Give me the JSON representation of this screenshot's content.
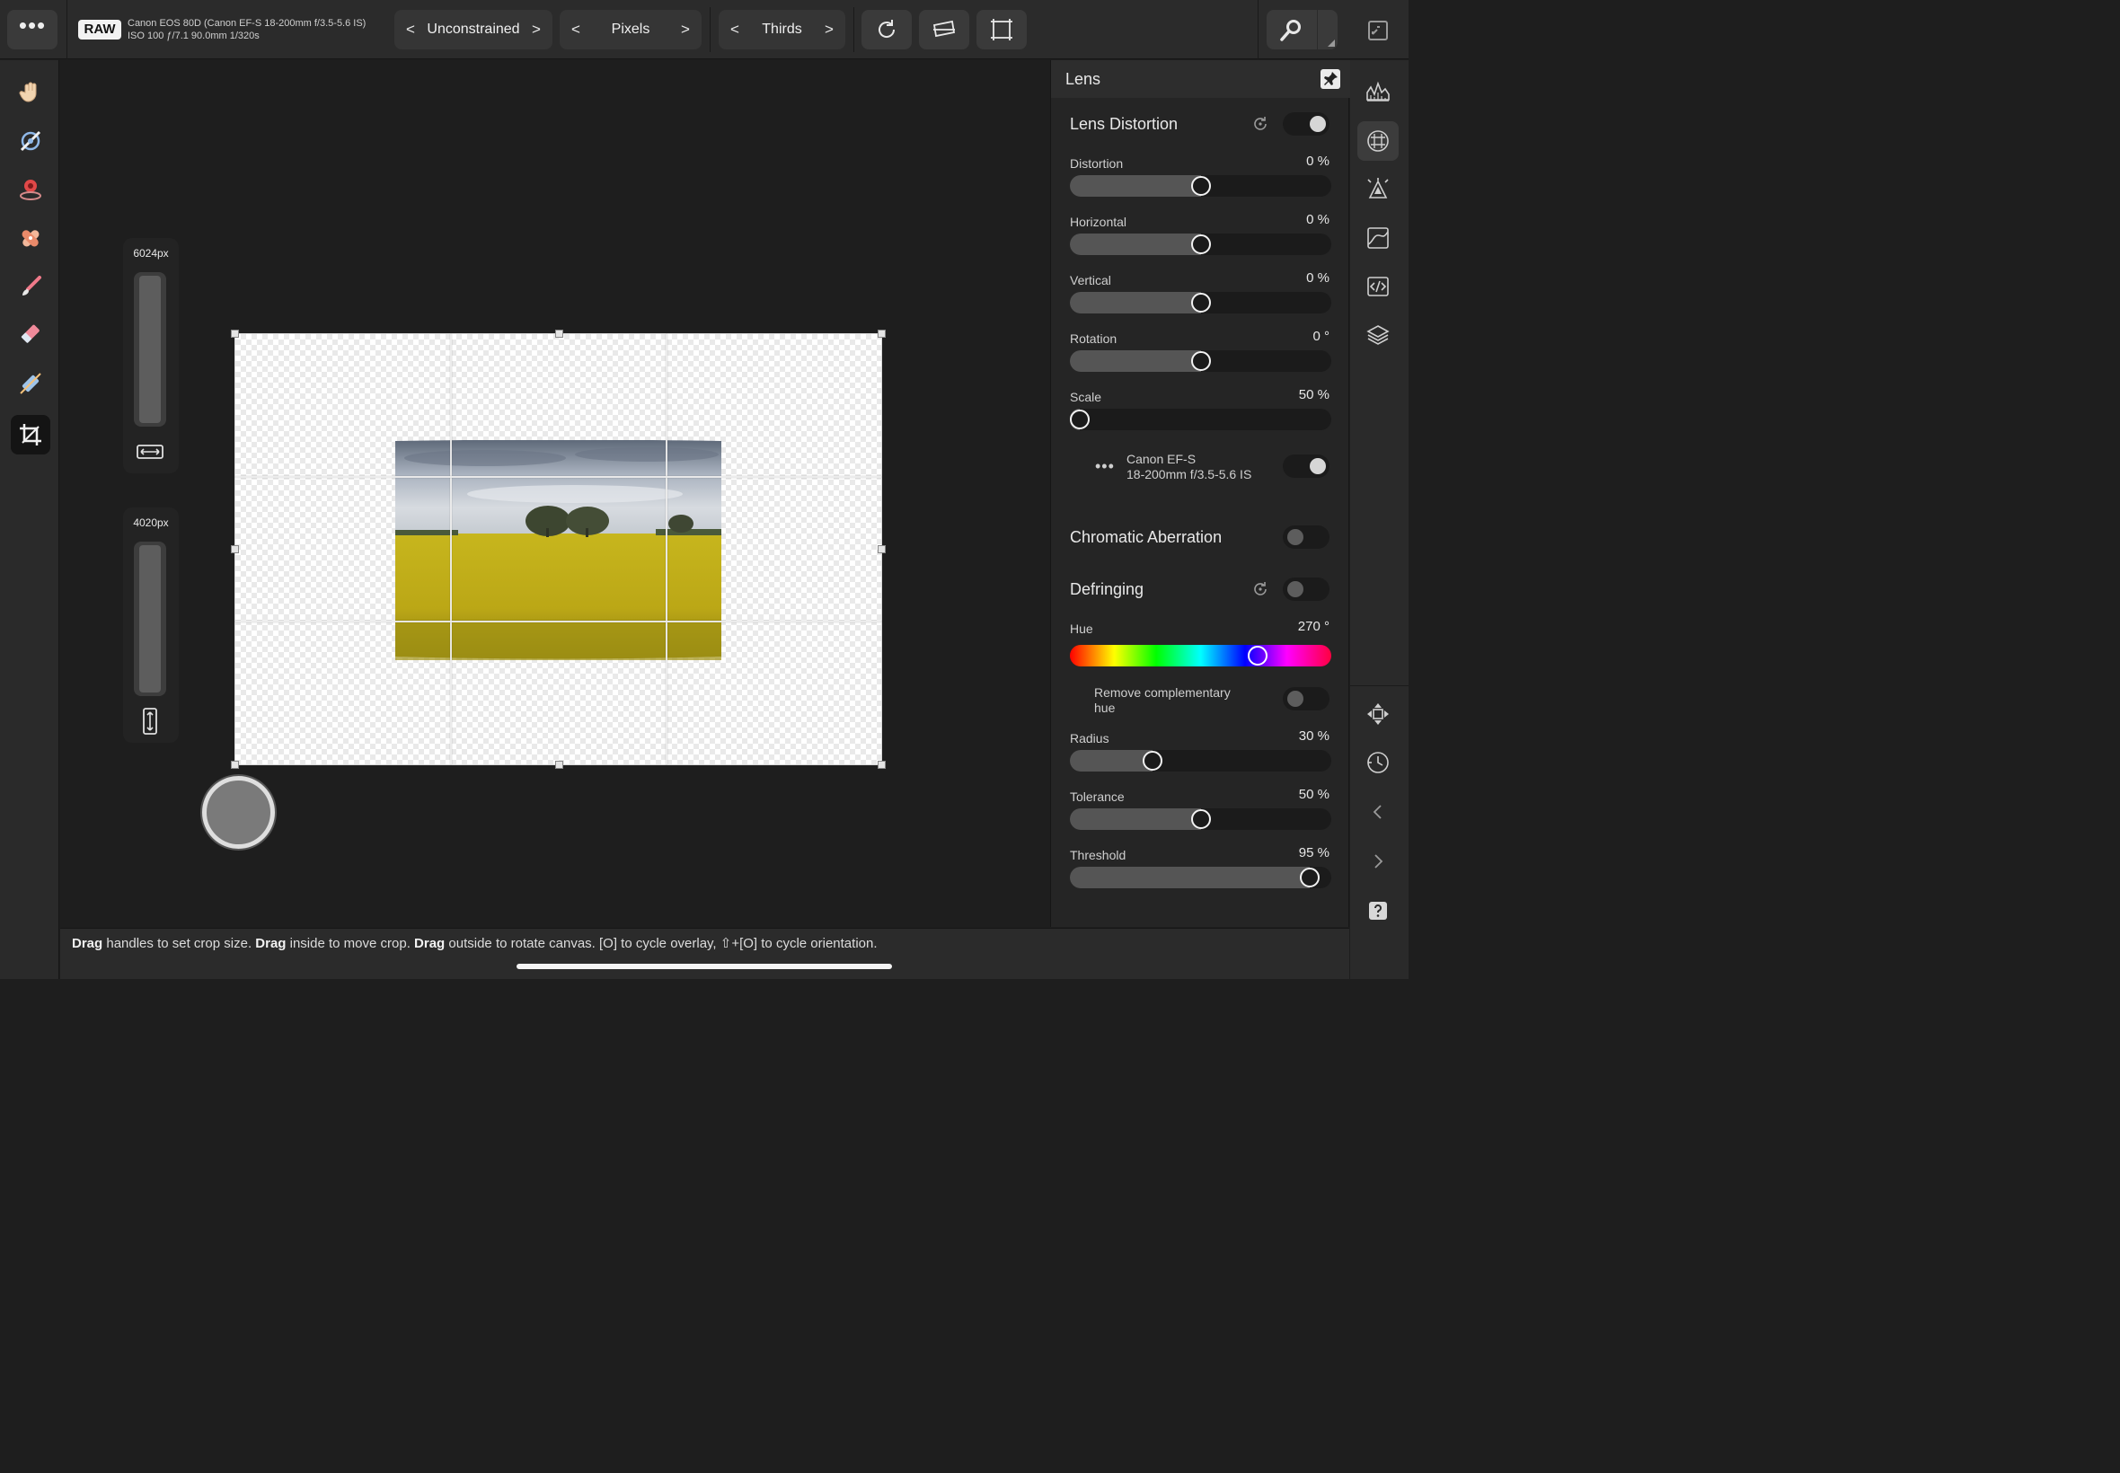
{
  "toolbar": {
    "menu_label": "•••",
    "raw_badge": "RAW",
    "exif_line1": "Canon EOS 80D (Canon EF-S 18-200mm f/3.5-5.6 IS)",
    "exif_line2": "ISO 100 ƒ/7.1 90.0mm 1/320s",
    "ratio_mode": "Unconstrained",
    "units_mode": "Pixels",
    "overlay_mode": "Thirds",
    "chev_left": "<",
    "chev_right": ">"
  },
  "left_tools": [
    "view-tool",
    "white-balance-tool",
    "red-eye-tool",
    "blemish-tool",
    "overlay-paint-tool",
    "overlay-erase-tool",
    "overlay-gradient-tool",
    "crop-tool"
  ],
  "active_tool": "crop-tool",
  "canvas": {
    "width_label": "6024px",
    "height_label": "4020px",
    "width_slider_level": 1.0,
    "height_slider_level": 1.0
  },
  "panel": {
    "title": "Lens",
    "lens_distortion": {
      "title": "Lens Distortion",
      "enabled": true,
      "controls": [
        {
          "key": "distortion",
          "label": "Distortion",
          "value": "0 %",
          "level": 0.5
        },
        {
          "key": "horizontal",
          "label": "Horizontal",
          "value": "0 %",
          "level": 0.5
        },
        {
          "key": "vertical",
          "label": "Vertical",
          "value": "0 %",
          "level": 0.5
        },
        {
          "key": "rotation",
          "label": "Rotation",
          "value": "0 °",
          "level": 0.5
        },
        {
          "key": "scale",
          "label": "Scale",
          "value": "50 %",
          "level": 0.0
        }
      ],
      "profile_more": "•••",
      "profile_line1": "Canon EF-S",
      "profile_line2": "18-200mm f/3.5-5.6 IS",
      "profile_enabled": true
    },
    "chromatic_aberration": {
      "title": "Chromatic Aberration",
      "enabled": false
    },
    "defringing": {
      "title": "Defringing",
      "enabled": false,
      "hue": {
        "label": "Hue",
        "value": "270 °",
        "level": 0.735
      },
      "remove_comp_line1": "Remove complementary",
      "remove_comp_line2": "hue",
      "remove_comp_enabled": false,
      "controls": [
        {
          "key": "radius",
          "label": "Radius",
          "value": "30 %",
          "level": 0.3
        },
        {
          "key": "tolerance",
          "label": "Tolerance",
          "value": "50 %",
          "level": 0.5
        },
        {
          "key": "threshold",
          "label": "Threshold",
          "value": "95 %",
          "level": 0.95
        }
      ]
    }
  },
  "right_rail": [
    "histogram-icon",
    "lens-icon",
    "details-icon",
    "tones-icon",
    "develop-code-icon",
    "layers-icon",
    "navigator-icon",
    "history-icon",
    "chevron-left-icon",
    "chevron-right-icon",
    "help-icon"
  ],
  "status": {
    "b1": "Drag",
    "t1": " handles to set crop size. ",
    "b2": "Drag",
    "t2": " inside to move crop. ",
    "b3": "Drag",
    "t3": " outside to rotate canvas. [O] to cycle overlay, ⇧+[O] to cycle orientation."
  },
  "colors": {
    "accent": "#f2f2f2",
    "panel_bg": "#252525",
    "toolbar_bg": "#2b2b2b"
  }
}
